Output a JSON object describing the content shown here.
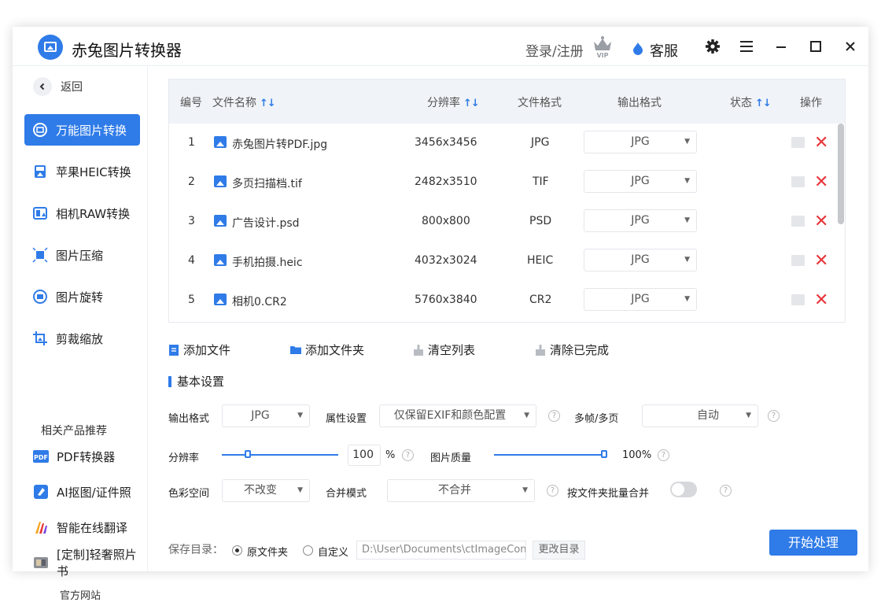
{
  "app": {
    "title": "赤兔图片转换器",
    "login_label": "登录/注册",
    "service_label": "客服"
  },
  "sidebar": {
    "back_label": "返回",
    "items": [
      {
        "label": "万能图片转换",
        "icon": "image-convert-icon",
        "active": true
      },
      {
        "label": "苹果HEIC转换",
        "icon": "heic-icon",
        "active": false
      },
      {
        "label": "相机RAW转换",
        "icon": "raw-icon",
        "active": false
      },
      {
        "label": "图片压缩",
        "icon": "compress-icon",
        "active": false
      },
      {
        "label": "图片旋转",
        "icon": "rotate-icon",
        "active": false
      },
      {
        "label": "剪裁缩放",
        "icon": "crop-icon",
        "active": false
      }
    ],
    "related_title": "相关产品推荐",
    "products": [
      {
        "label": "PDF转换器",
        "icon": "pdf-icon"
      },
      {
        "label": "AI抠图/证件照",
        "icon": "ai-cutout-icon"
      },
      {
        "label": "智能在线翻译",
        "icon": "translate-icon"
      },
      {
        "label": "[定制]轻奢照片书",
        "icon": "photobook-icon"
      }
    ],
    "official_site": "官方网站"
  },
  "table": {
    "headers": {
      "index": "编号",
      "name": "文件名称",
      "resolution": "分辨率",
      "format": "文件格式",
      "output": "输出格式",
      "status": "状态",
      "actions": "操作"
    },
    "rows": [
      {
        "index": "1",
        "name": "赤兔图片转PDF.jpg",
        "resolution": "3456x3456",
        "format": "JPG",
        "output": "JPG",
        "status": ""
      },
      {
        "index": "2",
        "name": "多页扫描档.tif",
        "resolution": "2482x3510",
        "format": "TIF",
        "output": "JPG",
        "status": ""
      },
      {
        "index": "3",
        "name": "广告设计.psd",
        "resolution": "800x800",
        "format": "PSD",
        "output": "JPG",
        "status": ""
      },
      {
        "index": "4",
        "name": "手机拍摄.heic",
        "resolution": "4032x3024",
        "format": "HEIC",
        "output": "JPG",
        "status": ""
      },
      {
        "index": "5",
        "name": "相机0.CR2",
        "resolution": "5760x3840",
        "format": "CR2",
        "output": "JPG",
        "status": ""
      }
    ]
  },
  "actions": {
    "add_file": "添加文件",
    "add_folder": "添加文件夹",
    "clear_list": "清空列表",
    "clear_done": "清除已完成"
  },
  "settings": {
    "section_title": "基本设置",
    "output_format_label": "输出格式",
    "output_format_value": "JPG",
    "attr_label": "属性设置",
    "attr_value": "仅保留EXIF和颜色配置",
    "frames_label": "多帧/多页",
    "frames_value": "自动",
    "resolution_label": "分辨率",
    "resolution_value": "100",
    "resolution_unit": "%",
    "resolution_percent": 22,
    "quality_label": "图片质量",
    "quality_value": "100%",
    "quality_percent": 100,
    "color_label": "色彩空间",
    "color_value": "不改变",
    "merge_label": "合并模式",
    "merge_value": "不合并",
    "batch_merge_label": "按文件夹批量合并",
    "batch_merge_on": false,
    "help_glyph": "?"
  },
  "save": {
    "label": "保存目录：",
    "option_original": "原文件夹",
    "option_custom": "自定义",
    "path": "D:\\User\\Documents\\ctImageConverter",
    "change_label": "更改目录"
  },
  "start_label": "开始处理",
  "colors": {
    "accent": "#2f7be8",
    "danger": "#e8363a"
  }
}
